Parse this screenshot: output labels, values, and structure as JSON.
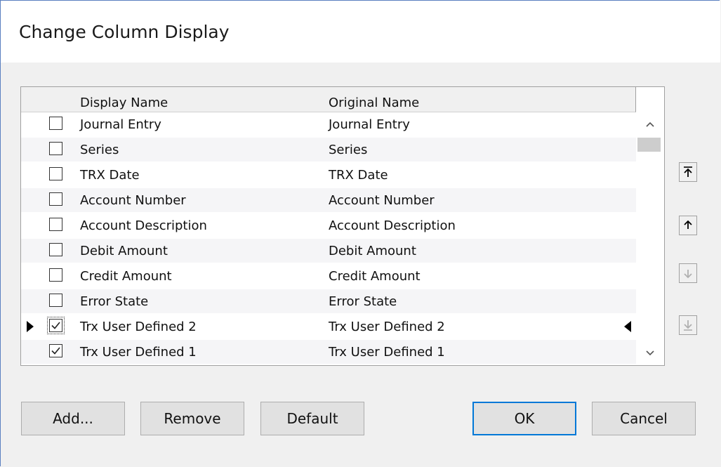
{
  "dialog": {
    "title": "Change Column Display"
  },
  "list": {
    "columns": [
      "Display Name",
      "Original Name"
    ],
    "rows": [
      {
        "display": "Journal Entry",
        "original": "Journal Entry",
        "checked": false
      },
      {
        "display": "Series",
        "original": "Series",
        "checked": false
      },
      {
        "display": "TRX Date",
        "original": "TRX Date",
        "checked": false
      },
      {
        "display": "Account Number",
        "original": "Account Number",
        "checked": false
      },
      {
        "display": "Account Description",
        "original": "Account Description",
        "checked": false
      },
      {
        "display": "Debit Amount",
        "original": "Debit Amount",
        "checked": false
      },
      {
        "display": "Credit Amount",
        "original": "Credit Amount",
        "checked": false
      },
      {
        "display": "Error State",
        "original": "Error State",
        "checked": false
      },
      {
        "display": "Trx User Defined 2",
        "original": "Trx User Defined 2",
        "checked": true,
        "current": true
      },
      {
        "display": "Trx User Defined 1",
        "original": "Trx User Defined 1",
        "checked": true
      }
    ]
  },
  "side_buttons": [
    {
      "name": "move-to-top-button",
      "icon": "arrow-top-icon",
      "enabled": true
    },
    {
      "name": "move-up-button",
      "icon": "arrow-up-icon",
      "enabled": true
    },
    {
      "name": "move-down-button",
      "icon": "arrow-down-icon",
      "enabled": false
    },
    {
      "name": "move-to-bottom-button",
      "icon": "arrow-bottom-icon",
      "enabled": false
    }
  ],
  "buttons": {
    "add": "Add...",
    "remove": "Remove",
    "default": "Default",
    "ok": "OK",
    "cancel": "Cancel"
  },
  "colors": {
    "accent": "#0078d7",
    "button_face": "#e1e1e1",
    "dialog_bg": "#f0f0f0"
  }
}
